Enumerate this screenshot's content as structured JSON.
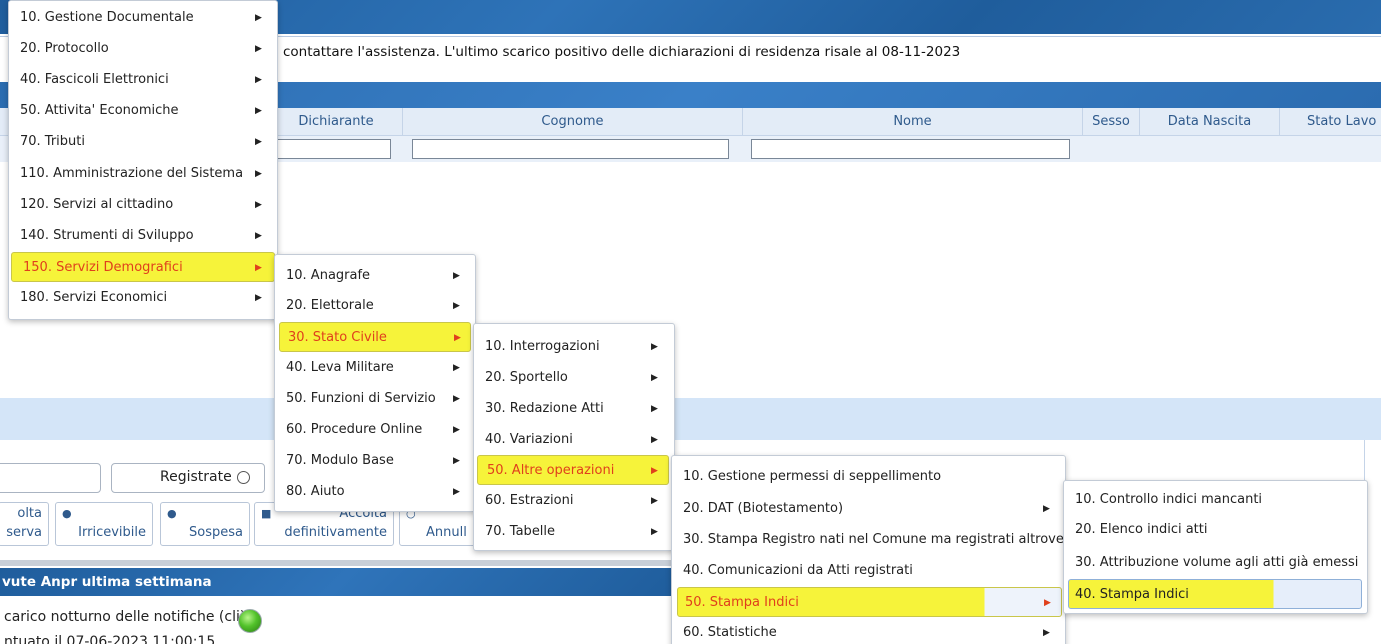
{
  "notice": {
    "text": "contattare l'assistenza. L'ultimo scarico positivo delle dichiarazioni di residenza risale al 08-11-2023"
  },
  "grid": {
    "columns": [
      "Dichiarante",
      "Cognome",
      "Nome",
      "Sesso",
      "Data Nascita",
      "Stato Lavo"
    ]
  },
  "filters": {
    "registrate_label": "Registrate"
  },
  "actions": {
    "accolta_l1": "olta",
    "accolta_l2": "serva",
    "irricevibile": "Irricevibile",
    "sospesa": "Sospesa",
    "accolta_def_l1": "Accolta",
    "accolta_def_l2": "definitivamente",
    "annulla": "Annull"
  },
  "panel": {
    "title": "vute Anpr ultima settimana",
    "line1": "carico notturno delle notifiche (cli)",
    "line2": "ntuato il 07-06-2023 11:00:15"
  },
  "menus": {
    "main": [
      {
        "label": "10. Gestione Documentale"
      },
      {
        "label": "20. Protocollo"
      },
      {
        "label": "40. Fascicoli Elettronici"
      },
      {
        "label": "50. Attivita' Economiche"
      },
      {
        "label": "70. Tributi"
      },
      {
        "label": "110. Amministrazione del Sistema"
      },
      {
        "label": "120. Servizi al cittadino"
      },
      {
        "label": "140. Strumenti di Sviluppo"
      },
      {
        "label": "150. Servizi Demografici",
        "highlight": true
      },
      {
        "label": "180. Servizi Economici"
      }
    ],
    "demografici": [
      {
        "label": "10. Anagrafe"
      },
      {
        "label": "20. Elettorale"
      },
      {
        "label": "30. Stato Civile",
        "highlight": true
      },
      {
        "label": "40. Leva Militare"
      },
      {
        "label": "50. Funzioni di Servizio"
      },
      {
        "label": "60. Procedure Online"
      },
      {
        "label": "70. Modulo Base"
      },
      {
        "label": "80. Aiuto"
      }
    ],
    "stato_civile": [
      {
        "label": "10. Interrogazioni"
      },
      {
        "label": "20. Sportello"
      },
      {
        "label": "30. Redazione Atti"
      },
      {
        "label": "40. Variazioni"
      },
      {
        "label": "50. Altre operazioni",
        "highlight": true
      },
      {
        "label": "60. Estrazioni"
      },
      {
        "label": "70. Tabelle"
      }
    ],
    "altre_operazioni": [
      {
        "label": "10. Gestione permessi di seppellimento"
      },
      {
        "label": "20. DAT (Biotestamento)"
      },
      {
        "label": "30. Stampa Registro nati nel Comune ma registrati altrove"
      },
      {
        "label": "40. Comunicazioni da Atti registrati"
      },
      {
        "label": "50. Stampa Indici",
        "highlight": true
      },
      {
        "label": "60. Statistiche"
      }
    ],
    "stampa_indici": [
      {
        "label": "10. Controllo indici mancanti"
      },
      {
        "label": "20. Elenco indici atti"
      },
      {
        "label": "30. Attribuzione volume agli atti già emessi"
      },
      {
        "label": "40. Stampa Indici",
        "highlight": true
      }
    ]
  },
  "colors": {
    "highlight": "#f6f33a",
    "highlight_text": "#e0401c",
    "header_blue": "#2b6cb0"
  }
}
